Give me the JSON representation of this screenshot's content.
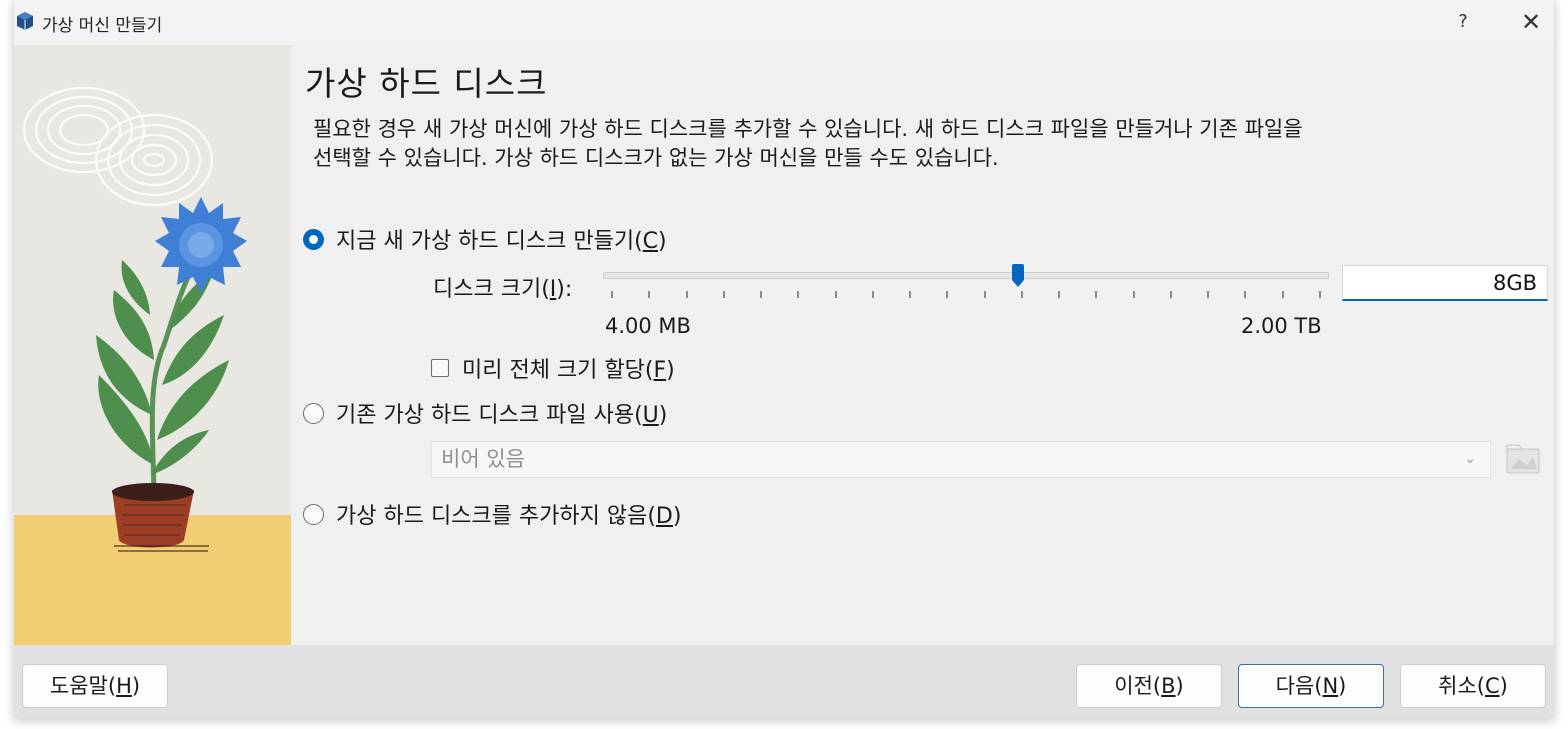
{
  "window": {
    "title": "가상 머신 만들기",
    "help": "?",
    "close": "✕"
  },
  "page": {
    "title": "가상 하드 디스크",
    "description": "필요한 경우 새 가상 머신에 가상 하드 디스크를 추가할 수 있습니다. 새 하드 디스크 파일을 만들거나 기존 파일을 선택할 수 있습니다. 가상 하드 디스크가 없는 가상 머신을 만들 수도 있습니다."
  },
  "options": {
    "create_new": {
      "label": "지금 새 가상 하드 디스크 만들기(",
      "mnemonic": "C",
      "suffix": ")",
      "selected": true
    },
    "use_existing": {
      "label": "기존 가상 하드 디스크 파일 사용(",
      "mnemonic": "U",
      "suffix": ")",
      "selected": false
    },
    "no_disk": {
      "label": "가상 하드 디스크를 추가하지 않음(",
      "mnemonic": "D",
      "suffix": ")",
      "selected": false
    }
  },
  "disk_size": {
    "label_prefix": "디스크 크기(",
    "mnemonic": "I",
    "label_suffix": "):",
    "min_label": "4.00 MB",
    "max_label": "2.00 TB",
    "value": "8GB",
    "slider_position_fraction": 0.574,
    "tick_count": 20
  },
  "preallocate": {
    "label_prefix": "미리 전체 크기 할당(",
    "mnemonic": "F",
    "label_suffix": ")",
    "checked": false
  },
  "existing_file": {
    "placeholder": "비어 있음"
  },
  "buttons": {
    "help": {
      "prefix": "도움말(",
      "mnemonic": "H",
      "suffix": ")"
    },
    "back": {
      "prefix": "이전(",
      "mnemonic": "B",
      "suffix": ")"
    },
    "next": {
      "prefix": "다음(",
      "mnemonic": "N",
      "suffix": ")"
    },
    "cancel": {
      "prefix": "취소(",
      "mnemonic": "C",
      "suffix": ")"
    }
  },
  "colors": {
    "accent": "#0067c0",
    "flower": "#3f7fd6",
    "leaf": "#4f8f4e",
    "pot": "#9c3d26",
    "floor": "#f2cd72"
  }
}
